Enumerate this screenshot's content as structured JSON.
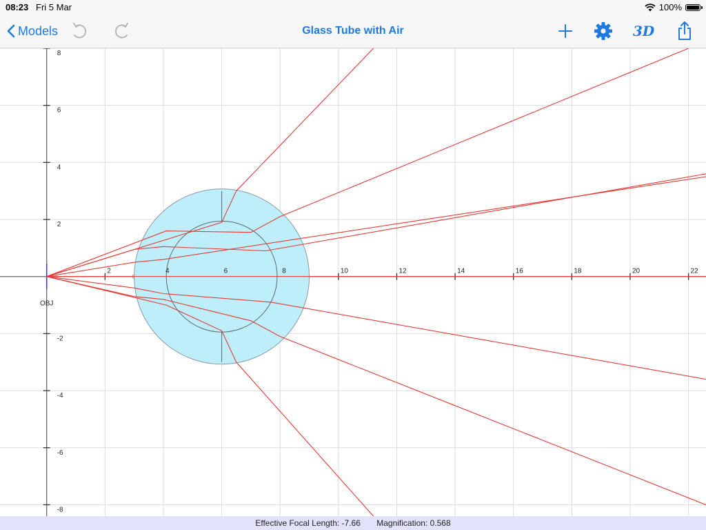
{
  "status_bar": {
    "time": "08:23",
    "date": "Fri 5 Mar",
    "battery": "100%"
  },
  "nav": {
    "back_label": "Models",
    "title": "Glass Tube with Air",
    "btn3d_label": "3D",
    "accent_color": "#1f7ae0",
    "icons": [
      "chevron-left-icon",
      "undo-icon",
      "redo-icon",
      "plus-icon",
      "gear-icon",
      "3d-icon",
      "share-icon"
    ]
  },
  "scene": {
    "object_label": "OBJ",
    "x_ticks": [
      "2",
      "4",
      "6",
      "8",
      "10",
      "12",
      "14",
      "16",
      "18",
      "20",
      "22"
    ],
    "y_ticks": [
      "8",
      "6",
      "4",
      "2",
      "-2",
      "-4",
      "-6",
      "-8"
    ],
    "xlim": [
      -1.6,
      22.6
    ],
    "ylim": [
      -8.4,
      8.0
    ],
    "tube": {
      "center": [
        6.0,
        0
      ],
      "outer_radius": 3.0,
      "inner_radius": 1.9,
      "fill": "#bdeefa",
      "stroke": "#8a9aa6"
    },
    "ray_color": "#e53935",
    "rays": [
      [
        [
          0,
          0
        ],
        [
          6.0,
          1.9
        ],
        [
          6.5,
          3.0
        ],
        [
          11.2,
          8.0
        ]
      ],
      [
        [
          0,
          0
        ],
        [
          4.1,
          1.6
        ],
        [
          7.0,
          1.55
        ],
        [
          8.0,
          2.1
        ],
        [
          22.0,
          8.0
        ]
      ],
      [
        [
          0,
          0
        ],
        [
          3.0,
          0.95
        ],
        [
          4.0,
          1.05
        ],
        [
          7.5,
          0.9
        ],
        [
          22.6,
          3.6
        ]
      ],
      [
        [
          0,
          0
        ],
        [
          3.0,
          0.5
        ],
        [
          4.0,
          0.6
        ],
        [
          22.6,
          3.5
        ]
      ],
      [
        [
          0,
          0
        ],
        [
          3.0,
          -0.4
        ],
        [
          4.0,
          -0.6
        ],
        [
          7.7,
          -0.9
        ],
        [
          22.6,
          -3.6
        ]
      ],
      [
        [
          0,
          0
        ],
        [
          3.0,
          -0.7
        ],
        [
          4.0,
          -0.8
        ],
        [
          7.0,
          -1.55
        ],
        [
          8.0,
          -2.1
        ],
        [
          22.6,
          -8.0
        ]
      ],
      [
        [
          0,
          0
        ],
        [
          4.1,
          -1.0
        ],
        [
          6.0,
          -1.9
        ],
        [
          6.5,
          -3.0
        ],
        [
          11.2,
          -8.4
        ]
      ]
    ],
    "interface_points": [
      [
        3.0,
        0
      ],
      [
        4.0,
        0
      ],
      [
        7.8,
        0
      ]
    ]
  },
  "footer": {
    "focal_length_label": "Effective Focal Length: -7.66",
    "magnification_label": "Magnification: 0.568"
  }
}
